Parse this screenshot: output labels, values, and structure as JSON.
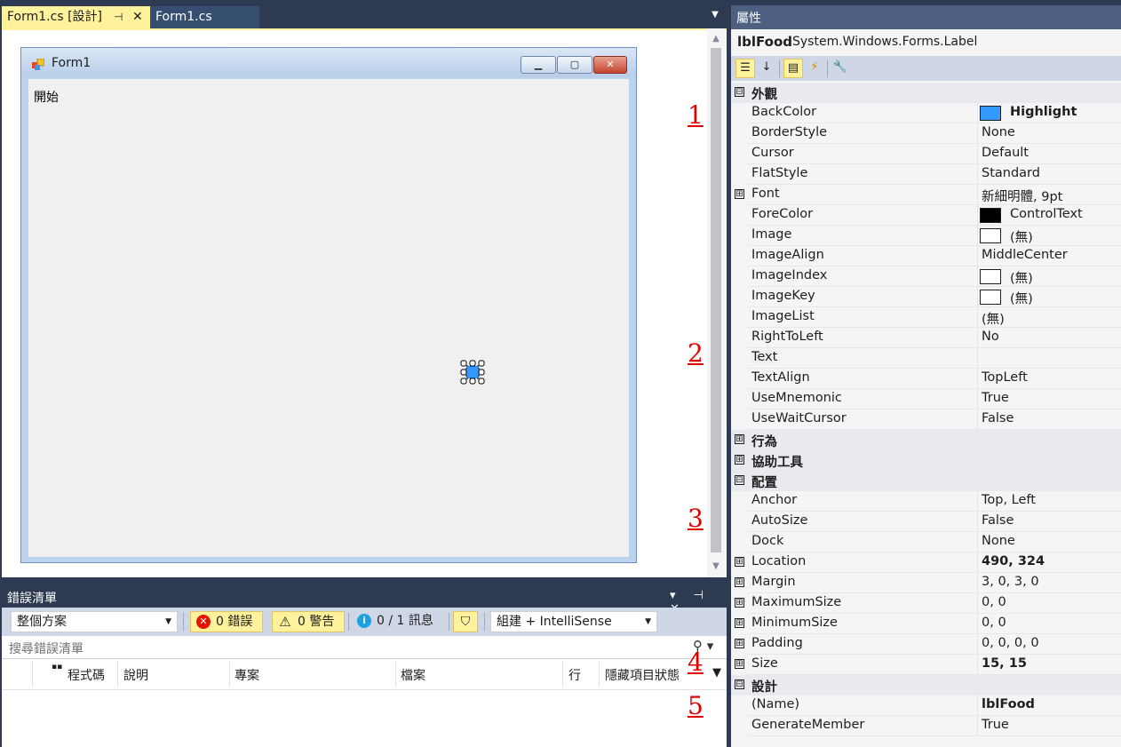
{
  "doc_tabs": {
    "active_label": "Form1.cs [設計]",
    "pin_glyph": "⊣",
    "close_glyph": "✕",
    "second_label": "Form1.cs",
    "dropdown_glyph": "▼"
  },
  "designer": {
    "form_title": "Form1",
    "min_glyph": "▁",
    "max_glyph": "▢",
    "close_glyph": "✕",
    "label_text": "開始",
    "annotations": [
      "1",
      "2",
      "3",
      "4",
      "5"
    ]
  },
  "error_list": {
    "title": "錯誤清單",
    "title_controls": "▾ ⊣ ✕",
    "scope": "整個方案",
    "errors": "0 錯誤",
    "warnings": "0 警告",
    "messages": "0 / 1 訊息",
    "build_filter": "組建 + IntelliSense",
    "search_placeholder": "搜尋錯誤清單",
    "columns": [
      "程式碼",
      "說明",
      "專案",
      "檔案",
      "行",
      "隱藏項目狀態"
    ]
  },
  "properties": {
    "title": "屬性",
    "object_name": "lblFood",
    "object_type": "System.Windows.Forms.Label",
    "rows": [
      {
        "kind": "cat",
        "name": "外觀",
        "exp": "⊟"
      },
      {
        "name": "BackColor",
        "value": "Highlight",
        "swatch": "#3399ff",
        "bold": true
      },
      {
        "name": "BorderStyle",
        "value": "None"
      },
      {
        "name": "Cursor",
        "value": "Default"
      },
      {
        "name": "FlatStyle",
        "value": "Standard"
      },
      {
        "name": "Font",
        "value": "新細明體, 9pt",
        "exp": "⊞"
      },
      {
        "name": "ForeColor",
        "value": "ControlText",
        "swatch": "#000000"
      },
      {
        "name": "Image",
        "value": "(無)",
        "swatch": "#ffffff"
      },
      {
        "name": "ImageAlign",
        "value": "MiddleCenter"
      },
      {
        "name": "ImageIndex",
        "value": "(無)",
        "swatch": "#ffffff"
      },
      {
        "name": "ImageKey",
        "value": "(無)",
        "swatch": "#ffffff"
      },
      {
        "name": "ImageList",
        "value": "(無)"
      },
      {
        "name": "RightToLeft",
        "value": "No"
      },
      {
        "name": "Text",
        "value": "",
        "selected": true
      },
      {
        "name": "TextAlign",
        "value": "TopLeft"
      },
      {
        "name": "UseMnemonic",
        "value": "True"
      },
      {
        "name": "UseWaitCursor",
        "value": "False"
      },
      {
        "kind": "cat",
        "name": "行為",
        "exp": "⊞"
      },
      {
        "kind": "cat",
        "name": "協助工具",
        "exp": "⊞"
      },
      {
        "kind": "cat",
        "name": "配置",
        "exp": "⊟"
      },
      {
        "name": "Anchor",
        "value": "Top, Left"
      },
      {
        "name": "AutoSize",
        "value": "False"
      },
      {
        "name": "Dock",
        "value": "None"
      },
      {
        "name": "Location",
        "value": "490, 324",
        "exp": "⊞",
        "bold": true
      },
      {
        "name": "Margin",
        "value": "3, 0, 3, 0",
        "exp": "⊞"
      },
      {
        "name": "MaximumSize",
        "value": "0, 0",
        "exp": "⊞"
      },
      {
        "name": "MinimumSize",
        "value": "0, 0",
        "exp": "⊞"
      },
      {
        "name": "Padding",
        "value": "0, 0, 0, 0",
        "exp": "⊞"
      },
      {
        "name": "Size",
        "value": "15, 15",
        "exp": "⊞",
        "bold": true
      },
      {
        "kind": "cat",
        "name": "設計",
        "exp": "⊟"
      },
      {
        "name": "(Name)",
        "value": "lblFood",
        "bold": true
      },
      {
        "name": "GenerateMember",
        "value": "True"
      }
    ]
  },
  "colors": {
    "accent_tab": "#fff29d",
    "chrome": "#2d3a52",
    "highlight": "#3399ff"
  }
}
